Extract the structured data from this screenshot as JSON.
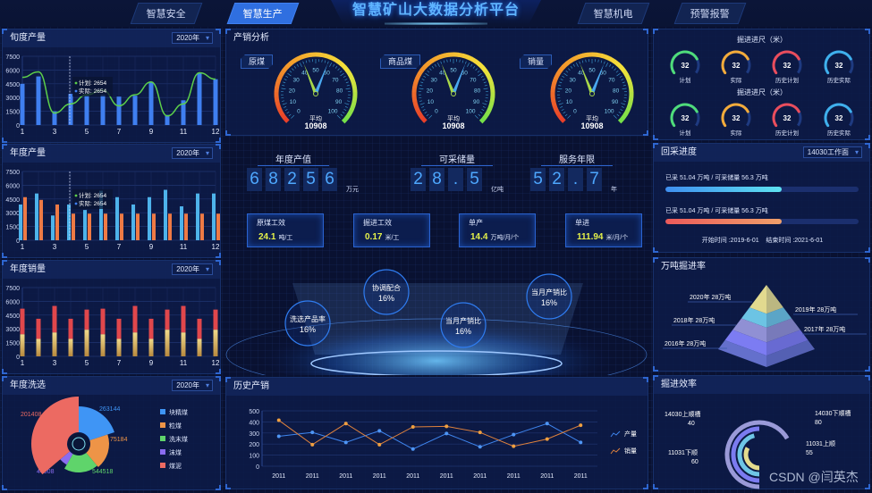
{
  "header": {
    "title": "智慧矿山大数据分析平台",
    "tabs": [
      {
        "label": "智慧安全",
        "active": false
      },
      {
        "label": "智慧生产",
        "active": true
      },
      {
        "label": "智慧机电",
        "active": false
      },
      {
        "label": "预警报警",
        "active": false
      }
    ]
  },
  "left": {
    "xundu": {
      "title": "旬度产量",
      "select": "2020年",
      "chart": {
        "type": "bar",
        "yticks": [
          0,
          1500,
          3000,
          4500,
          6000,
          7500
        ],
        "ylim": [
          0,
          7500
        ],
        "tick_labels": [
          "1",
          "",
          "3",
          "",
          "5",
          "",
          "7",
          "",
          "9",
          "",
          "11",
          "",
          "12"
        ],
        "bars": [
          4500,
          5300,
          1500,
          3400,
          3300,
          3300,
          3100,
          3200,
          4700,
          1100,
          2700,
          5700,
          5000
        ],
        "line": [
          5200,
          5800,
          1300,
          2300,
          3300,
          3800,
          2100,
          3300,
          4700,
          1000,
          2300,
          5700,
          5000
        ],
        "tooltip": {
          "plan_label": "计划: 2654",
          "actual_label": "实际: 2654"
        },
        "colors": {
          "bar": "#3f7ff0",
          "line": "#5ccf4a"
        }
      }
    },
    "niandu": {
      "title": "年度产量",
      "select": "2020年",
      "chart": {
        "type": "bar",
        "yticks": [
          0,
          1500,
          3000,
          4500,
          6000,
          7500
        ],
        "ylim": [
          0,
          7500
        ],
        "tick_labels": [
          "1",
          "",
          "3",
          "",
          "5",
          "",
          "7",
          "",
          "9",
          "",
          "11",
          "",
          "12"
        ],
        "series": [
          {
            "values": [
              3900,
              5100,
              2700,
              3900,
              3300,
              5400,
              4700,
              3900,
              4700,
              5500,
              3700,
              5100,
              5100
            ],
            "color": "#4eb3ea"
          },
          {
            "values": [
              4700,
              4400,
              3900,
              2900,
              2900,
              2900,
              2900,
              2900,
              2900,
              2900,
              2900,
              2900,
              2900
            ],
            "color": "#ee7a45"
          }
        ],
        "tooltip": {
          "plan_label": "计划: 2654",
          "actual_label": "实际: 2654"
        }
      }
    },
    "xiaoliang": {
      "title": "年度销量",
      "select": "2020年",
      "chart": {
        "type": "bar",
        "stacked": true,
        "yticks": [
          0,
          1500,
          3000,
          4500,
          6000,
          7500
        ],
        "ylim": [
          0,
          7500
        ],
        "tick_labels": [
          "1",
          "",
          "3",
          "",
          "5",
          "",
          "7",
          "",
          "9",
          "",
          "11",
          "",
          "12"
        ],
        "bottom": [
          2400,
          1900,
          2600,
          1900,
          2900,
          2400,
          1900,
          2600,
          1900,
          2900,
          2600,
          1900,
          2900
        ],
        "total": [
          5200,
          4100,
          5500,
          4100,
          5100,
          5200,
          4100,
          5500,
          4100,
          5100,
          5500,
          4100,
          5100
        ],
        "colors": {
          "bottom": "#d9b85c",
          "top": "#e0474c"
        }
      }
    },
    "xixuan": {
      "title": "年度洗选",
      "select": "2020年",
      "chart": {
        "type": "pie",
        "rose": true,
        "slices": [
          {
            "name": "块精煤",
            "value": 263144,
            "color": "#3f95f5"
          },
          {
            "name": "粒煤",
            "value": 75184,
            "color": "#ee9447"
          },
          {
            "name": "洗末煤",
            "value": 544518,
            "color": "#5fd46b"
          },
          {
            "name": "沫煤",
            "value": 44008,
            "color": "#8a6cf0"
          },
          {
            "name": "煤泥",
            "value": 201408,
            "color": "#ec6a62"
          }
        ]
      }
    }
  },
  "center": {
    "chanxiao": {
      "title": "产销分析",
      "gauges": [
        {
          "label": "原煤",
          "avg_label": "平均",
          "avg": "10908",
          "needles": [
            42,
            58
          ]
        },
        {
          "label": "商品煤",
          "avg_label": "平均",
          "avg": "10908",
          "needles": [
            42,
            58
          ]
        },
        {
          "label": "销量",
          "avg_label": "平均",
          "avg": "10908",
          "needles": [
            42,
            58
          ]
        }
      ],
      "ticks": [
        "0",
        "10",
        "20",
        "30",
        "40",
        "50",
        "60",
        "70",
        "80",
        "90",
        "100"
      ]
    },
    "kpis": [
      {
        "title": "年度产值",
        "digits": [
          "6",
          "8",
          "2",
          "5",
          "6"
        ],
        "unit": "万元"
      },
      {
        "title": "可采储量",
        "digits": [
          "2",
          "8",
          ".",
          "5"
        ],
        "unit": "亿吨"
      },
      {
        "title": "服务年限",
        "digits": [
          "5",
          "2",
          ".",
          "7"
        ],
        "unit": "年"
      }
    ],
    "cards": [
      {
        "label": "原煤工效",
        "value": "24.1",
        "unit": "吨/工"
      },
      {
        "label": "掘进工效",
        "value": "0.17",
        "unit": "米/工"
      },
      {
        "label": "单产",
        "value": "14.4",
        "unit": "万吨/月/个"
      },
      {
        "label": "单进",
        "value": "111.94",
        "unit": "米/月/个"
      }
    ],
    "orbs": [
      {
        "label": "洗选产品率",
        "value": "16%"
      },
      {
        "label": "协调配合",
        "value": "16%"
      },
      {
        "label": "当月产销比",
        "value": "16%"
      },
      {
        "label": "当月产销比",
        "value": "16%"
      }
    ],
    "history": {
      "title": "历史产销",
      "chart": {
        "type": "line",
        "yticks": [
          0,
          100,
          200,
          300,
          400,
          500
        ],
        "ylim": [
          0,
          500
        ],
        "categories": [
          "2011",
          "2011",
          "2011",
          "2011",
          "2011",
          "2011",
          "2011",
          "2011",
          "2011",
          "2011"
        ],
        "series": [
          {
            "name": "产量",
            "values": [
              270,
              305,
              215,
              320,
              155,
              295,
              175,
              285,
              385,
              215
            ],
            "color": "#3f86f0"
          },
          {
            "name": "销量",
            "values": [
              415,
              195,
              385,
              195,
              355,
              360,
              305,
              180,
              245,
              370
            ],
            "color": "#e0823c"
          }
        ]
      }
    }
  },
  "right": {
    "jinchi": {
      "rows": [
        {
          "title": "掘进进尺（米）",
          "items": [
            {
              "label": "计划",
              "value": "32",
              "color": "#4fdc7a",
              "pct": 0.75
            },
            {
              "label": "实际",
              "value": "32",
              "color": "#f3ab3a",
              "pct": 0.75
            },
            {
              "label": "历史计划",
              "value": "32",
              "color": "#ea4d5c",
              "pct": 0.75
            },
            {
              "label": "历史实际",
              "value": "32",
              "color": "#3fb0ec",
              "pct": 0.75
            }
          ]
        },
        {
          "title": "掘进进尺（米）",
          "items": [
            {
              "label": "计划",
              "value": "32",
              "color": "#4fdc7a",
              "pct": 0.75
            },
            {
              "label": "实际",
              "value": "32",
              "color": "#f3ab3a",
              "pct": 0.75
            },
            {
              "label": "历史计划",
              "value": "32",
              "color": "#ea4d5c",
              "pct": 0.75
            },
            {
              "label": "历史实际",
              "value": "32",
              "color": "#3fb0ec",
              "pct": 0.75
            }
          ]
        }
      ]
    },
    "huicai": {
      "title": "回采进度",
      "select": "14030工作面",
      "bars": [
        {
          "text": "已采 51.04 万吨 / 可采储量 56.3 万吨",
          "progress": 0.6,
          "from": "#3f8ff0",
          "to": "#5ee2f0"
        },
        {
          "text": "已采 51.04 万吨 / 可采储量 56.3 万吨",
          "progress": 0.6,
          "from": "#ec5a5a",
          "to": "#f0a06a"
        }
      ],
      "time": "开始时间 :2019-6-01    结束时间 :2021-6-01"
    },
    "pyramid": {
      "title": "万吨掘进率",
      "layers": [
        {
          "label": "2020年  28万吨",
          "color": "#e2da8f"
        },
        {
          "label": "2019年  28万吨",
          "color": "#6cc4e4"
        },
        {
          "label": "2018年  28万吨",
          "color": "#9090d4"
        },
        {
          "label": "2017年  28万吨",
          "color": "#7c7cf2"
        },
        {
          "label": "2016年  28万吨",
          "color": "#6470cc"
        }
      ]
    },
    "efficiency": {
      "title": "掘进效率",
      "rings": [
        {
          "name": "14030下顺槽",
          "value": 80,
          "color": "#9a9ad8"
        },
        {
          "name": "11031下顺",
          "value": 60,
          "color": "#7b7bf0"
        },
        {
          "name": "11031上顺",
          "value": 55,
          "color": "#6ec6e6"
        },
        {
          "name": "14030上顺槽",
          "value": 40,
          "color": "#e4dc8e"
        }
      ],
      "max": 100
    }
  },
  "watermark": "CSDN @闫英杰"
}
